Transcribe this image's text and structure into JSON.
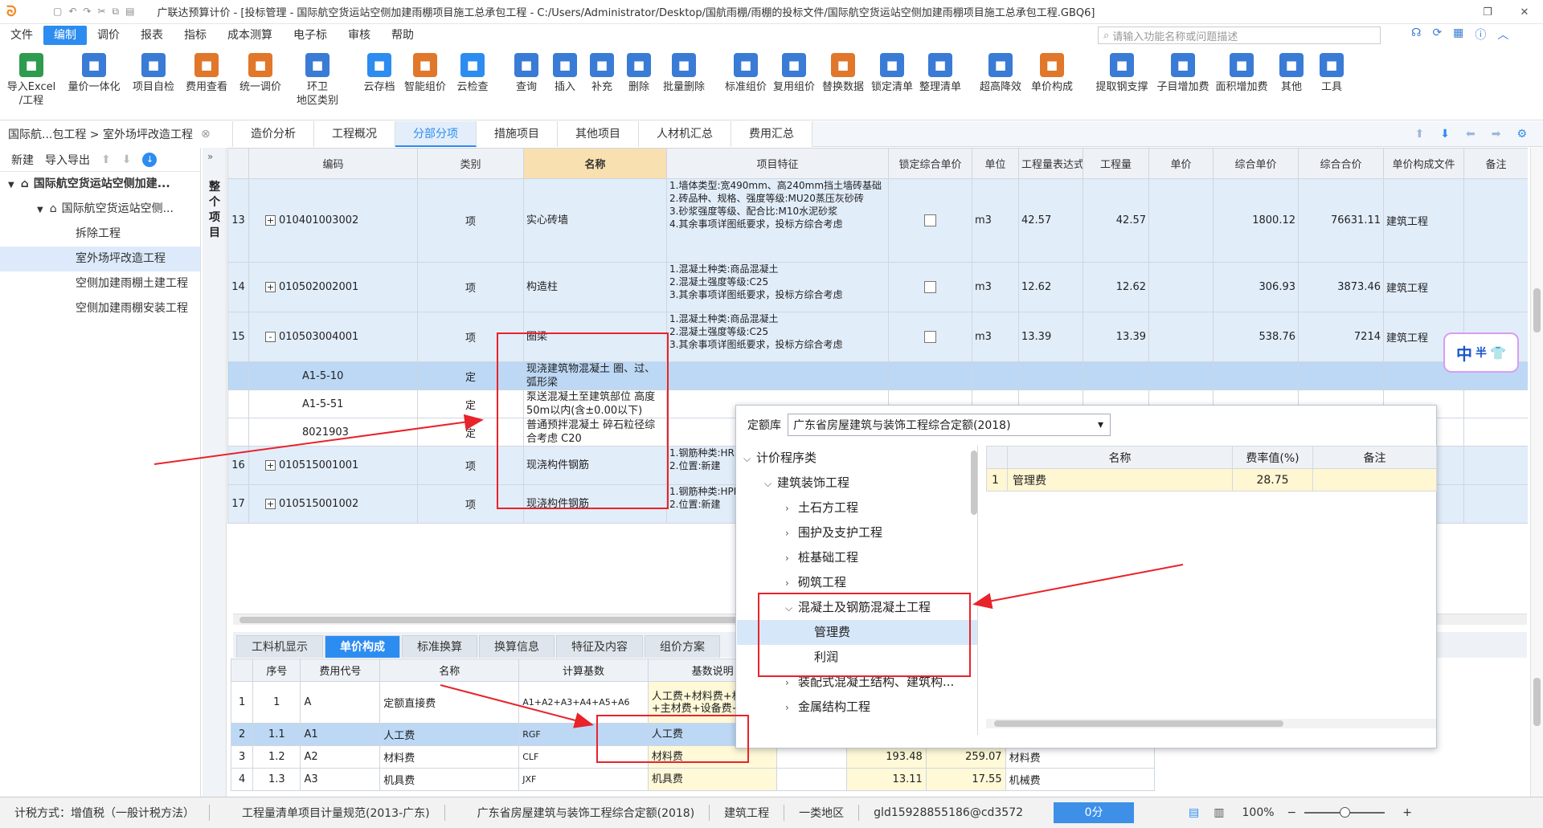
{
  "window": {
    "title": "广联达预算计价 - [投标管理 - 国际航空货运站空侧加建雨棚项目施工总承包工程 - C:/Users/Administrator/Desktop/国航雨棚/雨棚的投标文件/国际航空货运站空侧加建雨棚项目施工总承包工程.GBQ6]"
  },
  "menu": [
    "文件",
    "编制",
    "调价",
    "报表",
    "指标",
    "成本测算",
    "电子标",
    "审核",
    "帮助"
  ],
  "menu_active": "编制",
  "search": {
    "placeholder": "请输入功能名称或问题描述"
  },
  "ribbon": [
    {
      "label": "导入Excel\n/工程",
      "icon": "excel-import-icon",
      "color": "#2e9b4e"
    },
    {
      "label": "量价一体化",
      "icon": "balance-icon",
      "color": "#3a7bd5"
    },
    {
      "label": "项目自检",
      "icon": "check-icon",
      "color": "#3a7bd5"
    },
    {
      "label": "费用查看",
      "icon": "fee-view-icon",
      "color": "#e0772b"
    },
    {
      "label": "统一调价",
      "icon": "adjust-price-icon",
      "color": "#e0772b"
    },
    {
      "label": "环卫\n地区类别",
      "icon": "region-icon",
      "color": "#3a7bd5"
    },
    {
      "label": "云存档",
      "icon": "cloud-save-icon",
      "color": "#2d8cf0"
    },
    {
      "label": "智能组价",
      "icon": "smart-price-icon",
      "color": "#e0772b"
    },
    {
      "label": "云检查",
      "icon": "cloud-check-icon",
      "color": "#2d8cf0"
    },
    {
      "label": "查询",
      "icon": "query-icon",
      "color": "#3a7bd5"
    },
    {
      "label": "插入",
      "icon": "insert-icon",
      "color": "#3a7bd5"
    },
    {
      "label": "补充",
      "icon": "supplement-icon",
      "color": "#3a7bd5"
    },
    {
      "label": "删除",
      "icon": "delete-icon",
      "color": "#3a7bd5"
    },
    {
      "label": "批量删除",
      "icon": "batch-delete-icon",
      "color": "#3a7bd5"
    },
    {
      "label": "标准组价",
      "icon": "standard-price-icon",
      "color": "#3a7bd5"
    },
    {
      "label": "复用组价",
      "icon": "reuse-price-icon",
      "color": "#3a7bd5"
    },
    {
      "label": "替换数据",
      "icon": "replace-data-icon",
      "color": "#e0772b"
    },
    {
      "label": "锁定清单",
      "icon": "lock-icon",
      "color": "#3a7bd5"
    },
    {
      "label": "整理清单",
      "icon": "organize-icon",
      "color": "#3a7bd5"
    },
    {
      "label": "超高降效",
      "icon": "height-icon",
      "color": "#3a7bd5"
    },
    {
      "label": "单价构成",
      "icon": "unit-price-icon",
      "color": "#e0772b"
    },
    {
      "label": "提取钢支撑",
      "icon": "steel-icon",
      "color": "#3a7bd5"
    },
    {
      "label": "子目增加费",
      "icon": "sub-item-icon",
      "color": "#3a7bd5"
    },
    {
      "label": "面积增加费",
      "icon": "area-icon",
      "color": "#3a7bd5"
    },
    {
      "label": "其他",
      "icon": "other-icon",
      "color": "#3a7bd5"
    },
    {
      "label": "工具",
      "icon": "tools-icon",
      "color": "#3a7bd5"
    }
  ],
  "breadcrumb": "国际航...包工程 > 室外场坪改造工程",
  "tabs": [
    "造价分析",
    "工程概况",
    "分部分项",
    "措施项目",
    "其他项目",
    "人材机汇总",
    "费用汇总"
  ],
  "tab_active": "分部分项",
  "left": {
    "new_label": "新建",
    "io_label": "导入导出",
    "tree": [
      {
        "label": "国际航空货运站空侧加建...",
        "level": 0
      },
      {
        "label": "国际航空货运站空侧...",
        "level": 1
      },
      {
        "label": "拆除工程",
        "level": 2
      },
      {
        "label": "室外场坪改造工程",
        "level": 2,
        "selected": true
      },
      {
        "label": "空侧加建雨棚土建工程",
        "level": 2
      },
      {
        "label": "空侧加建雨棚安装工程",
        "level": 2
      }
    ]
  },
  "vertical_label": "整个项目",
  "grid": {
    "headers": [
      "",
      "编码",
      "类别",
      "名称",
      "项目特征",
      "锁定综合单价",
      "单位",
      "工程量表达式",
      "工程量",
      "单价",
      "综合单价",
      "综合合价",
      "单价构成文件",
      "备注"
    ],
    "rows": [
      {
        "no": "13",
        "code": "010401003002",
        "type": "项",
        "name": "实心砖墙",
        "feature": "1.墙体类型:宽490mm、高240mm挡土墙砖基础\n2.砖品种、规格、强度等级:MU20蒸压灰砂砖\n3.砂浆强度等级、配合比:M10水泥砂浆\n4.其余事项详图纸要求，投标方综合考虑",
        "unit": "m3",
        "expr": "42.57",
        "qty": "42.57",
        "uprice": "",
        "cprice": "1800.12",
        "ctotal": "76631.11",
        "file": "建筑工程",
        "kind": "item",
        "sign": "+"
      },
      {
        "no": "14",
        "code": "010502002001",
        "type": "项",
        "name": "构造柱",
        "feature": "1.混凝土种类:商品混凝土\n2.混凝土强度等级:C25\n3.其余事项详图纸要求，投标方综合考虑",
        "unit": "m3",
        "expr": "12.62",
        "qty": "12.62",
        "uprice": "",
        "cprice": "306.93",
        "ctotal": "3873.46",
        "file": "建筑工程",
        "kind": "item",
        "sign": "+"
      },
      {
        "no": "15",
        "code": "010503004001",
        "type": "项",
        "name": "圈梁",
        "feature": "1.混凝土种类:商品混凝土\n2.混凝土强度等级:C25\n3.其余事项详图纸要求，投标方综合考虑",
        "unit": "m3",
        "expr": "13.39",
        "qty": "13.39",
        "uprice": "",
        "cprice": "538.76",
        "ctotal": "7214",
        "file": "建筑工程",
        "kind": "item",
        "sign": "-"
      },
      {
        "no": "",
        "code": "A1-5-10",
        "type": "定",
        "name": "现浇建筑物混凝土 圈、过、弧形梁",
        "kind": "cur"
      },
      {
        "no": "",
        "code": "A1-5-51",
        "type": "定",
        "name": "泵送混凝土至建筑部位 高度50m以内(含±0.00以下)",
        "kind": "sub"
      },
      {
        "no": "",
        "code": "8021903",
        "type": "定",
        "name": "普通预拌混凝土 碎石粒径综合考虑 C20",
        "kind": "sub"
      },
      {
        "no": "16",
        "code": "010515001001",
        "type": "项",
        "name": "现浇构件钢筋",
        "feature": "1.钢筋种类:HRB400Φ12-\n2.位置:新建",
        "kind": "item",
        "sign": "+"
      },
      {
        "no": "17",
        "code": "010515001002",
        "type": "项",
        "name": "现浇构件钢筋",
        "feature": "1.钢筋种类:HPB300Φ10\n2.位置:新建",
        "kind": "item",
        "sign": "+"
      }
    ]
  },
  "bottom_tabs": [
    "工料机显示",
    "单价构成",
    "标准换算",
    "换算信息",
    "特征及内容",
    "组价方案"
  ],
  "bottom_tab_active": "单价构成",
  "bottom_grid": {
    "headers": [
      "",
      "序号",
      "费用代号",
      "名称",
      "计算基数",
      "基数说明"
    ],
    "rows": [
      {
        "no": "1",
        "seq": "1",
        "code": "A",
        "name": "定额直接费",
        "base": "A1+A2+A3+A4+A5+A6",
        "desc": "人工费+材料费+机具费+主材费+设备费+管理费"
      },
      {
        "no": "2",
        "seq": "1.1",
        "code": "A1",
        "name": "人工费",
        "base": "RGF",
        "desc": "人工费",
        "cur": true
      },
      {
        "no": "3",
        "seq": "1.2",
        "code": "A2",
        "name": "材料费",
        "base": "CLF",
        "desc": "材料费",
        "rate": "193.48",
        "amount": "259.07",
        "note": "材料费"
      },
      {
        "no": "4",
        "seq": "1.3",
        "code": "A3",
        "name": "机具费",
        "base": "JXF",
        "desc": "机具费",
        "rate": "13.11",
        "amount": "17.55",
        "note": "机械费"
      }
    ]
  },
  "popup": {
    "label": "定额库",
    "selected": "广东省房屋建筑与装饰工程综合定额(2018)",
    "tree": [
      {
        "label": "计价程序类",
        "level": 0,
        "open": true
      },
      {
        "label": "建筑装饰工程",
        "level": 1,
        "open": true
      },
      {
        "label": "土石方工程",
        "level": 2
      },
      {
        "label": "围护及支护工程",
        "level": 2
      },
      {
        "label": "桩基础工程",
        "level": 2
      },
      {
        "label": "砌筑工程",
        "level": 2
      },
      {
        "label": "混凝土及钢筋混凝土工程",
        "level": 2,
        "open": true
      },
      {
        "label": "管理费",
        "level": 3,
        "selected": true
      },
      {
        "label": "利润",
        "level": 3
      },
      {
        "label": "装配式混凝土结构、建筑构...",
        "level": 2
      },
      {
        "label": "金属结构工程",
        "level": 2
      }
    ],
    "table_headers": [
      "",
      "名称",
      "费率值(%)",
      "备注"
    ],
    "table_rows": [
      {
        "no": "1",
        "name": "管理费",
        "rate": "28.75",
        "note": ""
      }
    ]
  },
  "ime": {
    "label": "中",
    "mode": "半"
  },
  "status": {
    "tax": "计税方式：增值税（一般计税方法）",
    "spec": "工程量清单项目计量规范(2013-广东)",
    "quota": "广东省房屋建筑与装饰工程综合定额(2018)",
    "type": "建筑工程",
    "region": "一类地区",
    "user": "gld15928855186@cd3572",
    "score": "0分",
    "zoom": "100%"
  },
  "colors": {
    "accent": "#2d8cf0",
    "annotation": "#e8232a",
    "name_header": "#f9e0b0"
  }
}
